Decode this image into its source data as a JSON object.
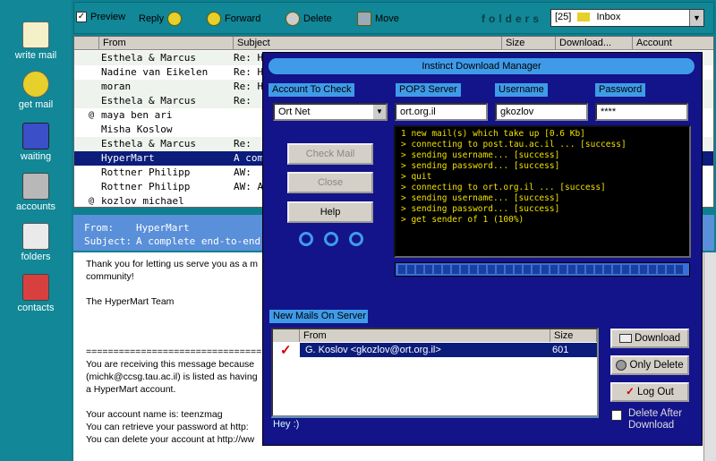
{
  "sidebar": {
    "items": [
      {
        "label": "write mail",
        "icon": "envelope-pencil-icon"
      },
      {
        "label": "get mail",
        "icon": "dog-mailbox-icon"
      },
      {
        "label": "waiting",
        "icon": "printer-icon"
      },
      {
        "label": "accounts",
        "icon": "computer-icon"
      },
      {
        "label": "folders",
        "icon": "paperclip-icon"
      },
      {
        "label": "contacts",
        "icon": "people-icon"
      }
    ]
  },
  "toolbar": {
    "preview": "Preview",
    "reply": "Reply",
    "forward": "Forward",
    "delete": "Delete",
    "move": "Move",
    "folders_label": "folders",
    "folder_count": "[25]",
    "folder_name": "Inbox"
  },
  "list": {
    "columns": [
      "From",
      "Subject",
      "Size",
      "Download...",
      "Account"
    ],
    "rows": [
      {
        "from": "Esthela & Marcus",
        "subject": "Re: H"
      },
      {
        "from": "Nadine van Eikelen",
        "subject": "Re: H"
      },
      {
        "from": "moran",
        "subject": "Re: H"
      },
      {
        "from": "Esthela & Marcus",
        "subject": "Re:"
      },
      {
        "from": "maya ben ari",
        "subject": ""
      },
      {
        "from": "Misha Koslow",
        "subject": ""
      },
      {
        "from": "Esthela & Marcus",
        "subject": "Re:"
      },
      {
        "from": "HyperMart",
        "subject": "A com"
      },
      {
        "from": "Rottner Philipp",
        "subject": "AW:"
      },
      {
        "from": "Rottner Philipp",
        "subject": "AW: A"
      },
      {
        "from": "kozlov michael",
        "subject": ""
      }
    ]
  },
  "preview": {
    "from_label": "From:",
    "from": "HyperMart",
    "subject_label": "Subject:",
    "subject": "A complete end-to-end e",
    "body": [
      "Thank you for letting us serve you as a m",
      "community!",
      "The HyperMart Team",
      "================================",
      "You are receiving this message because",
      "(michk@ccsg.tau.ac.il) is listed as having",
      "a HyperMart account.",
      "Your account name is:  teenzmag",
      "You can retrieve your password at http:",
      "You can delete your account at http://ww"
    ]
  },
  "dialog": {
    "title": "Instinct Download Manager",
    "account_label": "Account To Check",
    "pop3_label": "POP3 Server",
    "username_label": "Username",
    "password_label": "Password",
    "account_value": "Ort Net",
    "pop3_value": "ort.org.il",
    "username_value": "gkozlov",
    "password_value": "****",
    "check_mail": "Check Mail",
    "close": "Close",
    "help": "Help",
    "log": [
      "1 new mail(s) which take up [0.6 Kb]",
      "> connecting to post.tau.ac.il ... [success]",
      "> sending username... [success]",
      "> sending password... [success]",
      "> quit",
      "",
      "",
      "> connecting to ort.org.il ... [success]",
      "> sending username... [success]",
      "> sending password... [success]",
      "> get sender of 1 (100%)"
    ],
    "new_mails_label": "New Mails On Server",
    "mail_from_header": "From",
    "mail_size_header": "Size",
    "mail_from": "G. Koslov <gkozlov@ort.org.il>",
    "mail_size": "601",
    "status": "Hey :)",
    "download": "Download",
    "only_delete": "Only Delete",
    "log_out": "Log Out",
    "delete_after_download": "Delete After Download"
  }
}
